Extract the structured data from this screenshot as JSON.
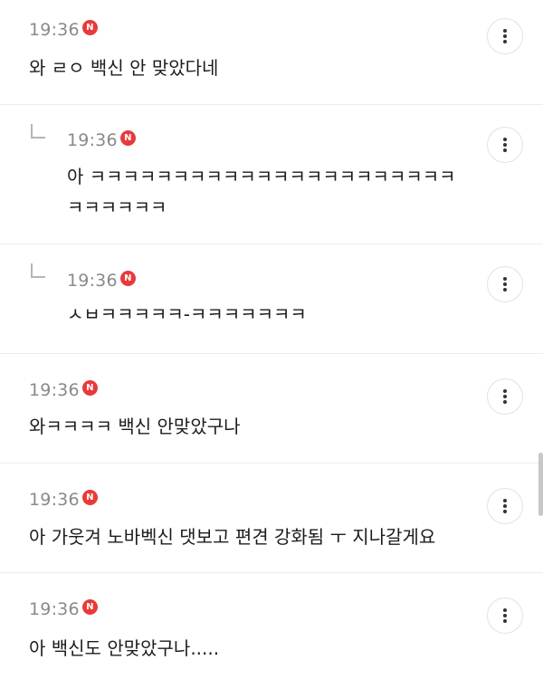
{
  "comments": [
    {
      "time": "19:36",
      "badge": "N",
      "text": "와 ㄹㅇ 백신 안 맞았다네",
      "is_reply": false
    },
    {
      "time": "19:36",
      "badge": "N",
      "text_line1": "아 ㅋㅋㅋㅋㅋㅋㅋㅋㅋㅋㅋㅋㅋㅋㅋㅋㅋㅋㅋㅋㅋㅋ",
      "text_line2": "ㅋㅋㅋㅋㅋㅋ",
      "is_reply": true
    },
    {
      "time": "19:36",
      "badge": "N",
      "text": "ㅅㅂㅋㅋㅋㅋㅋ-ㅋㅋㅋㅋㅋㅋㅋ",
      "is_reply": true
    },
    {
      "time": "19:36",
      "badge": "N",
      "text": "와ㅋㅋㅋㅋ 백신 안맞았구나",
      "is_reply": false
    },
    {
      "time": "19:36",
      "badge": "N",
      "text": "아 가웃겨 노바벡신 댓보고 편견 강화됨 ㅜ 지나갈게요",
      "is_reply": false
    },
    {
      "time": "19:36",
      "badge": "N",
      "text": "아 백신도 안맞았구나.....",
      "is_reply": false
    }
  ],
  "icons": {
    "more": "more-vertical-icon",
    "reply": "reply-arrow-icon"
  },
  "colors": {
    "badge": "#e83a3a",
    "time": "#8a8a8a",
    "text": "#1c1c1c",
    "divider": "#ececec"
  }
}
